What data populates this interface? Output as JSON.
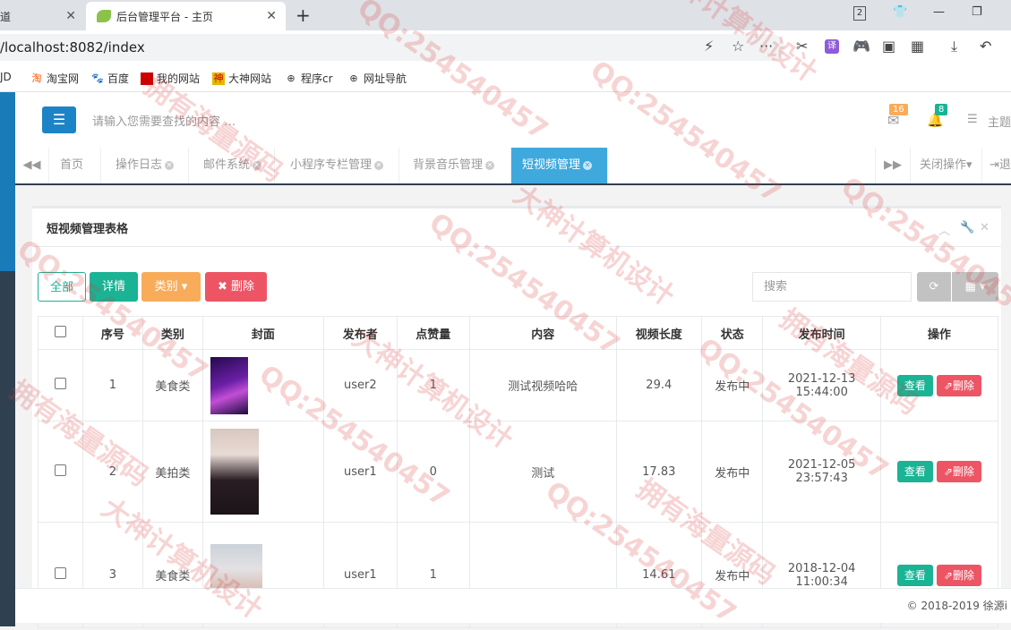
{
  "browser": {
    "tab_inactive_label": "道",
    "tab_active_label": "后台管理平台 - 主页",
    "tab_counter": "2",
    "address": "/localhost:8082/index",
    "bookmarks": [
      "JD",
      "淘宝网",
      "百度",
      "我的网站",
      "大神网站",
      "程序cr",
      "网址导航"
    ]
  },
  "topnav": {
    "search_placeholder": "请输入您需要查找的内容 …",
    "mail_badge": "16",
    "bell_badge": "8",
    "theme_label": "主题"
  },
  "content_tabs": {
    "items": [
      "首页",
      "操作日志",
      "邮件系统",
      "小程序专栏管理",
      "背景音乐管理",
      "短视频管理"
    ],
    "active_index": 5,
    "close_ops": "关闭操作",
    "exit": "退"
  },
  "panel": {
    "title": "短视频管理表格",
    "toolbar": {
      "all": "全部",
      "details": "详情",
      "category": "类别",
      "delete": "删除",
      "search_placeholder": "搜索"
    },
    "columns": [
      "",
      "序号",
      "类别",
      "封面",
      "发布者",
      "点赞量",
      "内容",
      "视频长度",
      "状态",
      "发布时间",
      "操作"
    ],
    "rows": [
      {
        "id": "1",
        "category": "美食类",
        "publisher": "user2",
        "likes": "1",
        "content": "测试视频哈哈",
        "length": "29.4",
        "status": "发布中",
        "date": "2021-12-13",
        "time": "15:44:00"
      },
      {
        "id": "2",
        "category": "美拍类",
        "publisher": "user1",
        "likes": "0",
        "content": "测试",
        "length": "17.83",
        "status": "发布中",
        "date": "2021-12-05",
        "time": "23:57:43"
      },
      {
        "id": "3",
        "category": "美食类",
        "publisher": "user1",
        "likes": "1",
        "content": "",
        "length": "14.61",
        "status": "发布中",
        "date": "2018-12-04",
        "time": "11:00:34"
      }
    ],
    "action_view": "查看",
    "action_delete": "删除"
  },
  "footer": {
    "copyright": "© 2018-2019 徐源i"
  },
  "watermarks": [
    "QQ:254540457",
    "拥有海量源码",
    "大神计算机设计"
  ],
  "colors": {
    "primary": "#1c84c6",
    "success": "#1ab394",
    "warning": "#f8ac59",
    "danger": "#ed5565",
    "active_tab": "#3fa9dd"
  }
}
